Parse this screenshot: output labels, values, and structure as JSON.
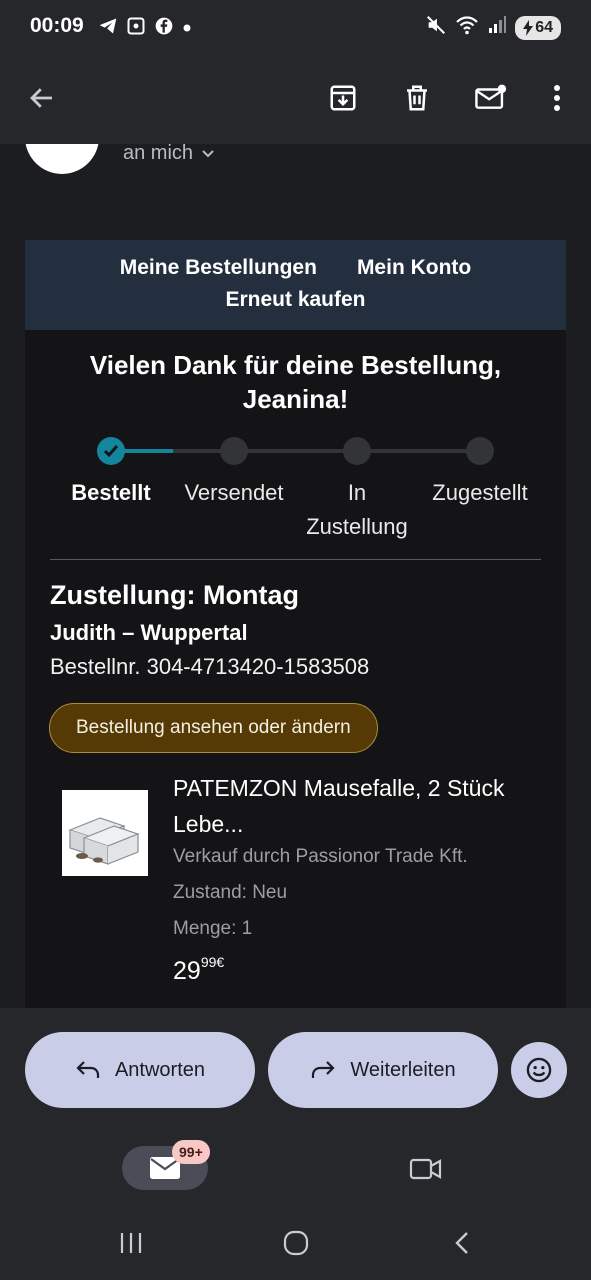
{
  "status_bar": {
    "time": "00:09",
    "left_icons": [
      "telegram-icon",
      "screenshot-icon",
      "facebook-icon",
      "dot-icon"
    ],
    "right_icons": [
      "mute-icon",
      "wifi-icon",
      "signal-icon"
    ],
    "battery": "64"
  },
  "app_bar": {
    "back_icon": "arrow-left-icon",
    "actions": [
      "archive-icon",
      "delete-icon",
      "mark-unread-icon",
      "more-vert-icon"
    ]
  },
  "email_header": {
    "to_text": "an mich"
  },
  "nav": {
    "my_orders": "Meine Bestellungen",
    "my_account": "Mein Konto",
    "buy_again": "Erneut kaufen"
  },
  "thanks_line1": "Vielen Dank für deine Bestellung,",
  "thanks_line2": "Jeanina!",
  "tracker": {
    "steps": [
      "Bestellt",
      "Versendet",
      "In",
      "Zustellung",
      "Zugestellt"
    ],
    "active_color": "#13869e"
  },
  "delivery": {
    "heading": "Zustellung: Montag",
    "recipient": "Judith – Wuppertal",
    "order_number": "Bestellnr. 304-4713420-1583508",
    "view_button": "Bestellung ansehen oder ändern"
  },
  "product": {
    "title_line1": "PATEMZON Mausefalle, 2 Stück",
    "title_line2": "Lebe...",
    "seller": "Verkauf durch Passionor Trade Kft.",
    "condition": "Zustand: Neu",
    "quantity": "Menge: 1",
    "price_main": "29",
    "price_sup": "99€"
  },
  "actions": {
    "reply": "Antworten",
    "forward": "Weiterleiten"
  },
  "bottom_nav": {
    "mail_badge": "99+"
  }
}
